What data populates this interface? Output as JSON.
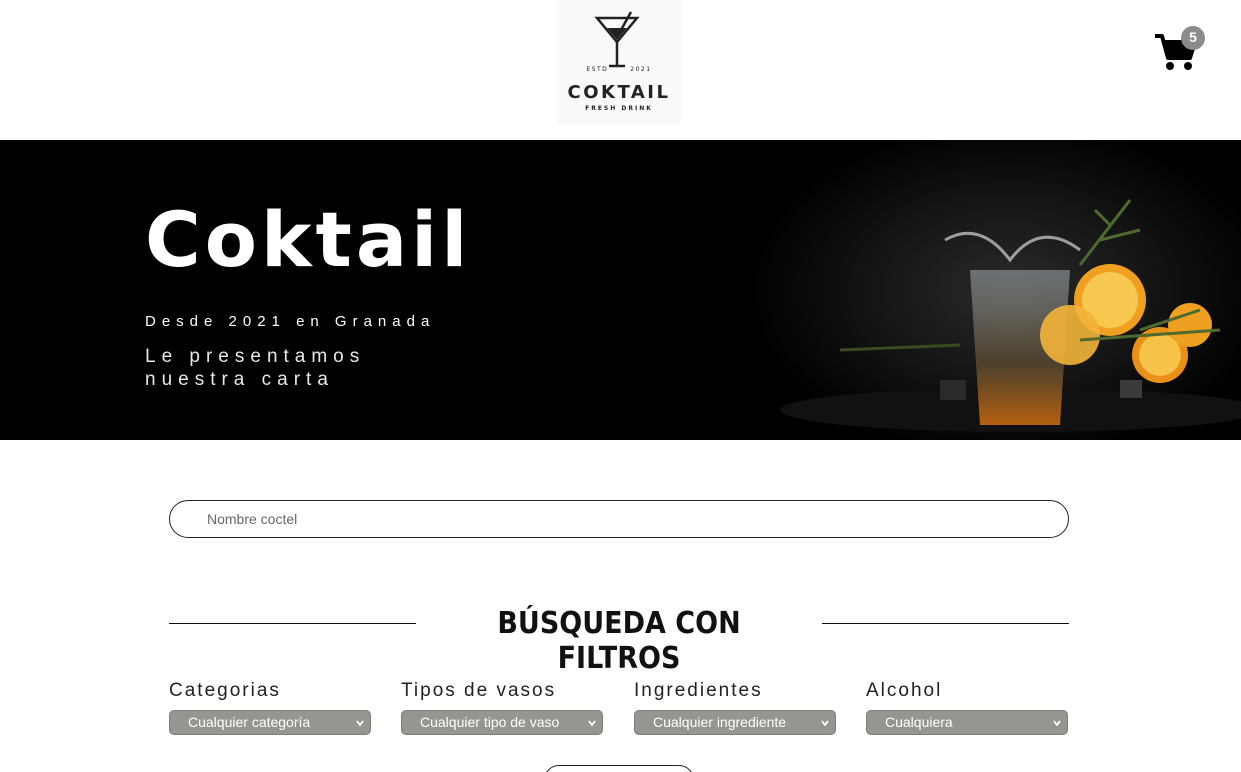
{
  "header": {
    "logo": {
      "estd_left": "ESTD",
      "estd_right": "2021",
      "brand": "COKTAIL",
      "tagline": "FRESH DRINK",
      "icon": "cocktail-glass-icon"
    },
    "cart": {
      "icon": "shopping-cart-icon",
      "count": "5"
    }
  },
  "hero": {
    "title": "Coktail",
    "subtitle": "Desde 2021 en Granada",
    "text_line1": "Le presentamos",
    "text_line2": "nuestra carta"
  },
  "search": {
    "placeholder": "Nombre coctel",
    "value": ""
  },
  "filters": {
    "title": "BÚSQUEDA CON FILTROS",
    "items": [
      {
        "label": "Categorias",
        "selected": "Cualquier categoría"
      },
      {
        "label": "Tipos de vasos",
        "selected": "Cualquier tipo de vaso"
      },
      {
        "label": "Ingredientes",
        "selected": "Cualquier ingrediente"
      },
      {
        "label": "Alcohol",
        "selected": "Cualquiera"
      }
    ]
  },
  "colors": {
    "hero_bg": "#000000",
    "select_bg": "#93978f",
    "badge_bg": "#8b8b8b"
  }
}
